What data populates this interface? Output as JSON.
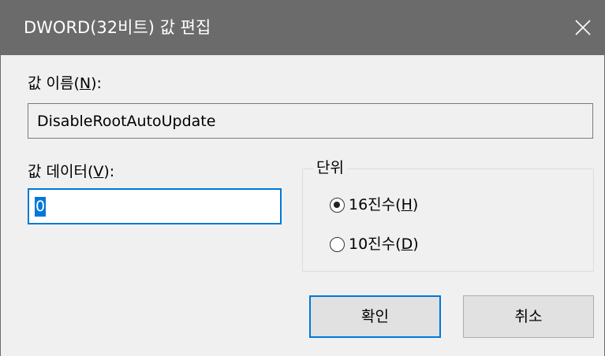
{
  "window": {
    "title": "DWORD(32비트) 값 편집",
    "close_icon": "close-icon"
  },
  "value_name": {
    "label_prefix": "값 이름(",
    "label_key": "N",
    "label_suffix": "):",
    "value": "DisableRootAutoUpdate"
  },
  "value_data": {
    "label_prefix": "값 데이터(",
    "label_key": "V",
    "label_suffix": "):",
    "value": "0"
  },
  "base": {
    "legend": "단위",
    "options": [
      {
        "label_prefix": "16진수(",
        "key": "H",
        "label_suffix": ")",
        "selected": true
      },
      {
        "label_prefix": "10진수(",
        "key": "D",
        "label_suffix": ")",
        "selected": false
      }
    ]
  },
  "buttons": {
    "ok": "확인",
    "cancel": "취소"
  },
  "colors": {
    "titlebar": "#6b6b6b",
    "accent": "#0078d7",
    "background": "#f0f0f0"
  }
}
